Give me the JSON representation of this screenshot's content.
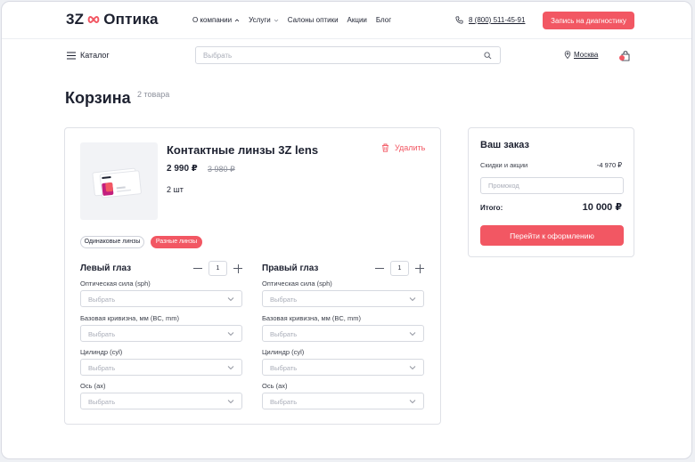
{
  "header": {
    "logo_mark": "3Z",
    "logo_text": "Оптика",
    "nav": [
      {
        "label": "О компании"
      },
      {
        "label": "Услуги"
      },
      {
        "label": "Салоны оптики"
      },
      {
        "label": "Акции"
      },
      {
        "label": "Блог"
      }
    ],
    "phone": "8 (800) 511-45-91",
    "cta": "Запись на диагностику"
  },
  "toolbar": {
    "catalog_label": "Каталог",
    "search_placeholder": "Выбрать",
    "city": "Москва"
  },
  "page": {
    "title": "Корзина",
    "items_count": "2 товара"
  },
  "product": {
    "name": "Контактные линзы 3Z lens",
    "price": "2 990 ₽",
    "old_price": "3 980 ₽",
    "quantity": "2 шт",
    "delete_label": "Удалить",
    "options": [
      "Одинаковые линзы",
      "Разные линзы"
    ],
    "selected_option": "Разные линзы"
  },
  "eyes": {
    "left": {
      "title": "Левый глаз",
      "count": "1"
    },
    "right": {
      "title": "Правый глаз",
      "count": "1"
    },
    "fields": [
      {
        "label": "Оптическая сила (sph)",
        "placeholder": "Выбрать"
      },
      {
        "label": "Базовая кривизна, мм (BC, mm)",
        "placeholder": "Выбрать"
      },
      {
        "label": "Цилиндр (cyl)",
        "placeholder": "Выбрать"
      },
      {
        "label": "Ось (ax)",
        "placeholder": "Выбрать"
      }
    ]
  },
  "order": {
    "title": "Ваш заказ",
    "discount_label": "Скидки и акции",
    "discount_value": "-4 970 ₽",
    "promo_placeholder": "Промокод",
    "total_label": "Итого:",
    "total_value": "10 000 ₽",
    "checkout_label": "Перейти к оформлению"
  },
  "colors": {
    "accent": "#f25763",
    "text": "#1d2130",
    "muted": "#8d919c",
    "border": "#dfe1e7"
  }
}
